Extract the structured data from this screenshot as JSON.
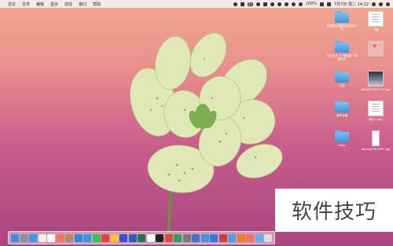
{
  "menubar": {
    "items": [
      "访达",
      "文件",
      "编辑",
      "显示",
      "前往",
      "窗口",
      "帮助"
    ],
    "status": {
      "badge": "25",
      "battery": "100%",
      "clock": "7月7日 周二 14:22"
    }
  },
  "desktop_icons": [
    {
      "label": "新建数字激励发布活动计划",
      "type": "folder"
    },
    {
      "label": "下载",
      "type": "doc"
    },
    {
      "label": "日行万步（一样健康）新建文件",
      "type": "folder"
    },
    {
      "label": "",
      "type": "pink"
    },
    {
      "label": "文档",
      "type": "folder"
    },
    {
      "label": "Wechat IMG1712.jpg",
      "type": "photo"
    },
    {
      "label": "营养品通",
      "type": "folder"
    },
    {
      "label": "图片1.png",
      "type": "doc"
    },
    {
      "label": "temp",
      "type": "folder"
    },
    {
      "label": "Wechat IMG1657.jpg",
      "type": "phone"
    }
  ],
  "watermark": "软件技巧",
  "dock_apps": [
    {
      "icon": "finder-icon",
      "color": "#3b8fe0"
    },
    {
      "icon": "launchpad-icon",
      "color": "#8e8e93"
    },
    {
      "icon": "safari-icon",
      "color": "#2e9cf0"
    },
    {
      "icon": "notes-icon",
      "color": "#f4f1e1"
    },
    {
      "icon": "reminders-icon",
      "color": "#ffffff"
    },
    {
      "icon": "photos-icon",
      "color": "#f07a5a"
    },
    {
      "icon": "contacts-icon",
      "color": "#b98b5f"
    },
    {
      "icon": "appstore-icon",
      "color": "#1f8cf0"
    },
    {
      "icon": "qq-icon",
      "color": "#2f9be8"
    },
    {
      "icon": "wechat-icon",
      "color": "#35c34a"
    },
    {
      "icon": "chrome-icon",
      "color": "#e7433a"
    },
    {
      "icon": "qqmusic-icon",
      "color": "#f3c52c"
    },
    {
      "icon": "baidu-icon",
      "color": "#2f54d9"
    },
    {
      "icon": "word-icon",
      "color": "#2b5eb8"
    },
    {
      "icon": "excel-icon",
      "color": "#1f7a45"
    },
    {
      "icon": "textedit-icon",
      "color": "#fafafa"
    },
    {
      "icon": "terminal-icon",
      "color": "#222222"
    },
    {
      "icon": "wps-icon",
      "color": "#e14b3c"
    },
    {
      "icon": "numbers-icon",
      "color": "#26a55a"
    },
    {
      "icon": "sysprefs-icon",
      "color": "#7a7a80"
    },
    {
      "icon": "network-icon",
      "color": "#3f74c9"
    },
    {
      "icon": "vpn-icon",
      "color": "#4a90e2"
    },
    {
      "icon": "xunlei-icon",
      "color": "#2f7ce6"
    },
    {
      "icon": "record-icon",
      "color": "#d23b3b"
    },
    {
      "icon": "mail-icon",
      "color": "#4aa3e8"
    },
    {
      "icon": "keynote-icon",
      "color": "#f07f20"
    },
    {
      "icon": "pinwheel-icon",
      "color": "#ff6f61"
    },
    {
      "icon": "folder-icon",
      "color": "#5bb0f0"
    },
    {
      "icon": "trash-icon",
      "color": "#dcdcdc"
    }
  ],
  "flower_colors": {
    "petal": "#dfe8b6",
    "petal_dark": "#c9d993",
    "speckle": "#a04d6b",
    "stem": "#6f8b47"
  }
}
